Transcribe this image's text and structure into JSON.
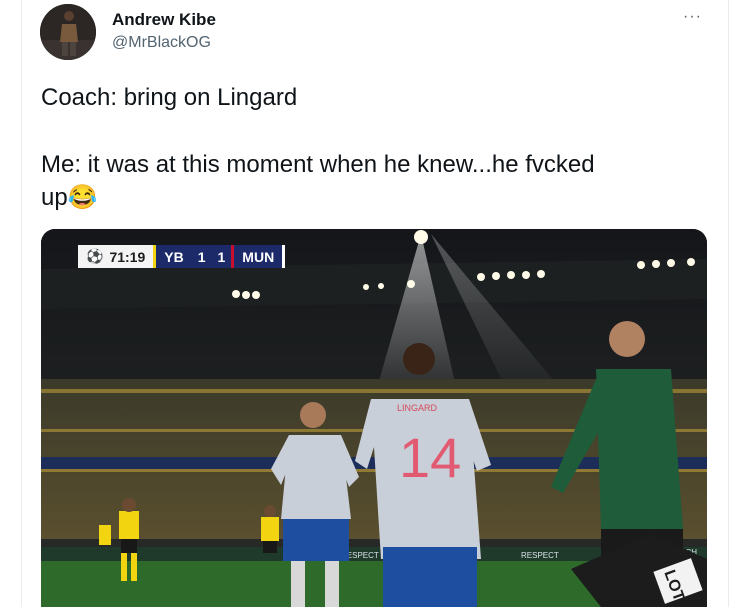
{
  "tweet": {
    "author_name": "Andrew Kibe",
    "author_handle": "@MrBlackOG",
    "more_label": "···",
    "line1": "Coach: bring on Lingard",
    "line2": "Me: it was at this moment when he knew...he fvcked",
    "line3": "up",
    "emoji": "😂"
  },
  "media": {
    "clock": "71:19",
    "home_team": "YB",
    "home_score": "1",
    "away_score": "1",
    "away_team": "MUN",
    "shirt_number": "14",
    "shirt_name": "LINGARD",
    "board_text": "EA CH",
    "board_text2": "RESPECT",
    "sign_text": "LOT",
    "colors": {
      "home_kit": "#f2d411",
      "away_kit": "#c9cfd8",
      "shorts": "#1d4ea0",
      "official": "#1e5c3a",
      "pitch": "#2e6b2a"
    }
  }
}
